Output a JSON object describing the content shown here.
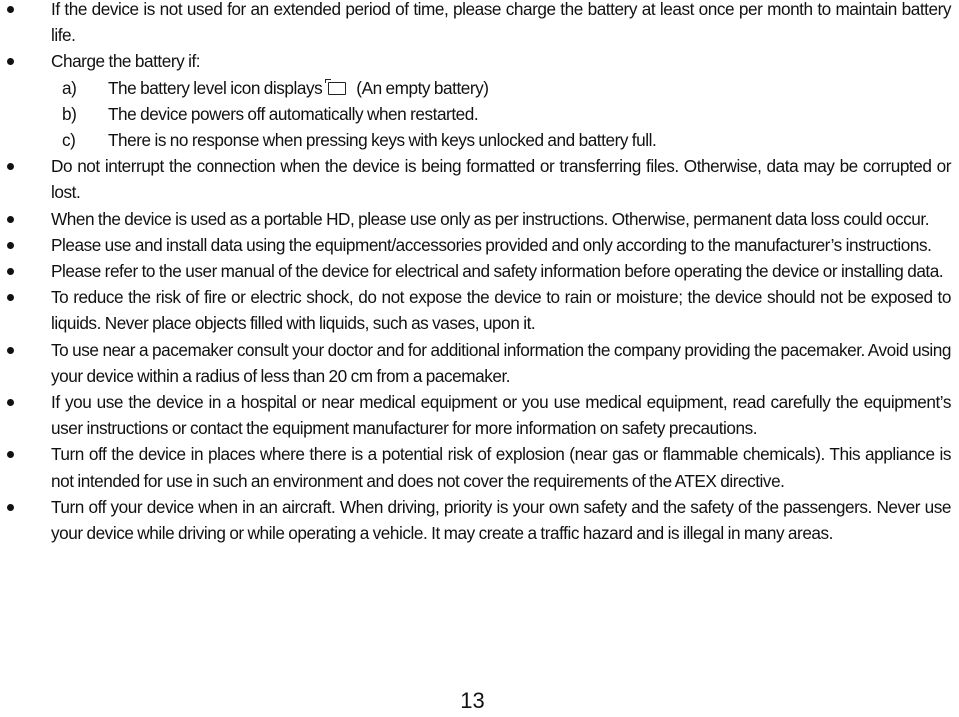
{
  "document": {
    "items": [
      {
        "text": "If the device is not used for an extended period of time, please charge the battery at least once per month to maintain battery life."
      },
      {
        "text": "Charge the battery if:"
      },
      {
        "text": "Do not interrupt the connection when the device is being formatted or transferring files. Otherwise, data may be corrupted or lost."
      },
      {
        "text": "When the device is used as a portable HD, please use only as per instructions. Otherwise, permanent data loss could occur."
      },
      {
        "text": "Please use and install data using the equipment/accessories provided and only according to the manufacturer’s instructions."
      },
      {
        "text": "Please refer to the user manual of the device for electrical and safety information before operating the device or installing data."
      },
      {
        "text": "To reduce the risk of fire or electric shock, do not expose the device to rain or moisture; the device should not be exposed to liquids. Never place objects filled with liquids, such as vases, upon it."
      },
      {
        "text": "To use near a pacemaker consult your doctor and for additional information the company providing the pacemaker. Avoid using your device within a radius of less than 20 cm from a pacemaker."
      },
      {
        "text": "If you use the device in a hospital or near medical equipment or you use medical equipment, read carefully the equipment’s user instructions or contact the equipment manufacturer for more information on safety precautions."
      },
      {
        "text": "Turn off the device in places where there is a potential risk of explosion (near gas or flammable chemicals). This appliance is not intended for use in such an environment and does not cover the requirements of the ATEX directive."
      },
      {
        "text": "Turn off your device when in an aircraft. When driving, priority is your own safety and the safety of the passengers. Never use your device while driving or while operating a vehicle. It may create a traffic hazard and is illegal in many areas."
      }
    ],
    "charge_conditions": [
      {
        "marker": "a)",
        "text_before": "The battery level icon displays",
        "icon": "empty-battery-icon",
        "text_after": "(An empty battery)"
      },
      {
        "marker": "b)",
        "text": "The device powers off automatically when restarted."
      },
      {
        "marker": "c)",
        "text": "There is no response when pressing keys with keys unlocked and battery full."
      }
    ],
    "page_number": "13"
  }
}
